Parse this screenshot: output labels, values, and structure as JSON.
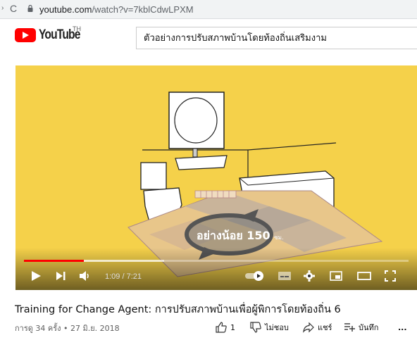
{
  "browser": {
    "url_host": "youtube.com",
    "url_path": "/watch?v=7kblCdwLPXM"
  },
  "header": {
    "brand": "YouTube",
    "region": "TH",
    "search_value": "ตัวอย่างการปรับสภาพบ้านโดยท้องถิ่นเสริมงาม"
  },
  "player": {
    "overlay_text": "อย่างน้อย 150",
    "overlay_unit": "ซม.",
    "time_current": "1:09",
    "time_total": "7:21",
    "time_display": "1:09 / 7:21",
    "progress_played_fraction": 0.156,
    "progress_loaded_fraction": 0.365,
    "scene_bg_color": "#f5d14a",
    "progress_color": "#ff0000"
  },
  "video": {
    "title": "Training for Change Agent: การปรับสภาพบ้านเพื่อผู้พิการโดยท้องถิ่น 6",
    "meta": "การดู 34 ครั้ง • 27 มิ.ย. 2018",
    "like_count": "1",
    "dislike_label": "ไม่ชอบ",
    "share_label": "แชร์",
    "save_label": "บันทึก",
    "more_label": "..."
  }
}
